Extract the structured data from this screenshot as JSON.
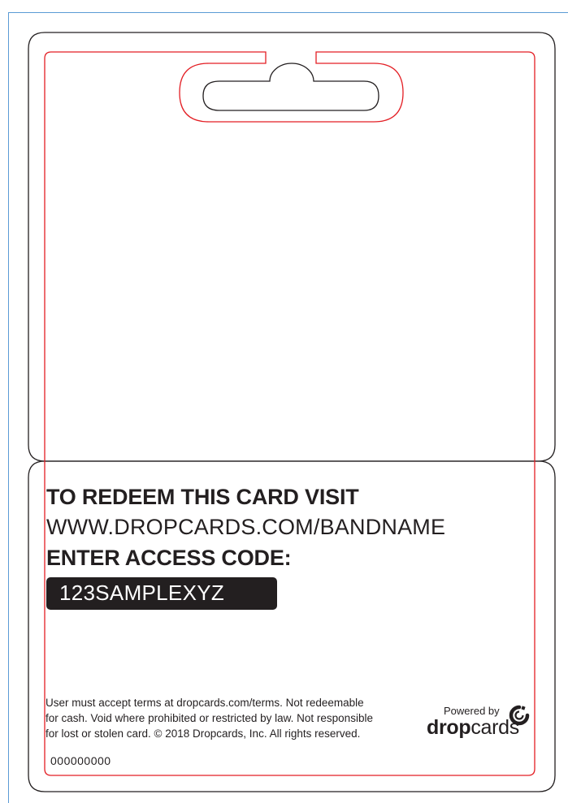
{
  "redeem": {
    "heading": "TO REDEEM THIS CARD VISIT",
    "url": "WWW.DROPCARDS.COM/BANDNAME",
    "code_heading": "ENTER ACCESS CODE:",
    "code": "123SAMPLEXYZ"
  },
  "legal": {
    "line1": "User must accept terms at dropcards.com/terms. Not redeemable",
    "line2": "for cash.  Void where prohibited or restricted by law. Not responsible",
    "line3": "for lost or stolen card. © 2018  Dropcards, Inc.  All rights reserved."
  },
  "serial": "000000000",
  "branding": {
    "powered_by": "Powered by",
    "brand_bold": "drop",
    "brand_light": "cards",
    "logo_icon": "dropcards-logo-icon"
  },
  "colors": {
    "trim_line": "#e31e24",
    "outline": "#231f20",
    "page_border": "#5b9bd5",
    "code_box": "#231f20"
  }
}
